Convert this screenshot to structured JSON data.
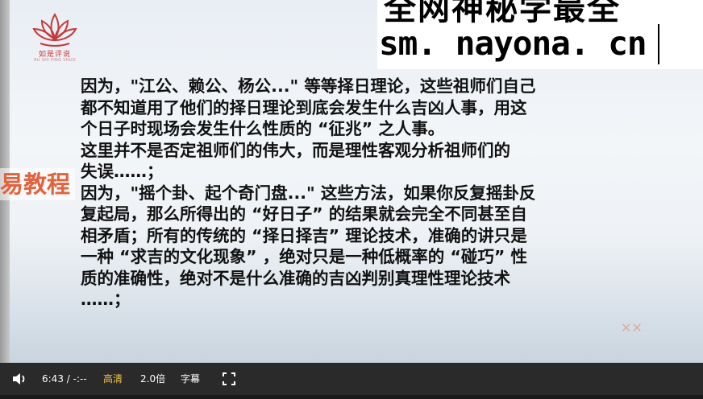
{
  "logo": {
    "text": "如是评说",
    "subtext": "RU SHI PING SHUO"
  },
  "banner": {
    "line1": "全网神秘学最全",
    "line2": "sm. nayona. cn"
  },
  "watermark": {
    "left": "易教程"
  },
  "slide": {
    "lines": [
      "因为，\"江公、赖公、杨公...\" 等等择日理论，这些祖师们自己",
      "都不知道用了他们的择日理论到底会发生什么吉凶人事，用这",
      "个日子时现场会发生什么性质的 “征兆” 之人事。",
      "这里并不是否定祖师们的伟大，而是理性客观分析祖师们的",
      "失误……；",
      "因为，\"摇个卦、起个奇门盘...\" 这些方法，如果你反复摇卦反",
      "复起局，那么所得出的 “好日子” 的结果就会完全不同甚至自",
      "相矛盾；所有的传统的 “择日择吉” 理论技术，准确的讲只是",
      "一种 “求吉的文化现象” ，绝对只是一种低概率的 “碰巧” 性",
      "质的准确性，绝对不是什么准确的吉凶判别真理性理论技术",
      "……；"
    ]
  },
  "player": {
    "time": "6:43 / -:--",
    "quality": "高清",
    "speed": "2.0倍",
    "subtitle": "字幕"
  },
  "colors": {
    "quality_accent": "#f2c14e",
    "watermark": "#e2623c",
    "logo": "#c43a3a"
  },
  "icons": [
    "volume-icon",
    "fullscreen-icon",
    "lotus-logo-icon"
  ]
}
